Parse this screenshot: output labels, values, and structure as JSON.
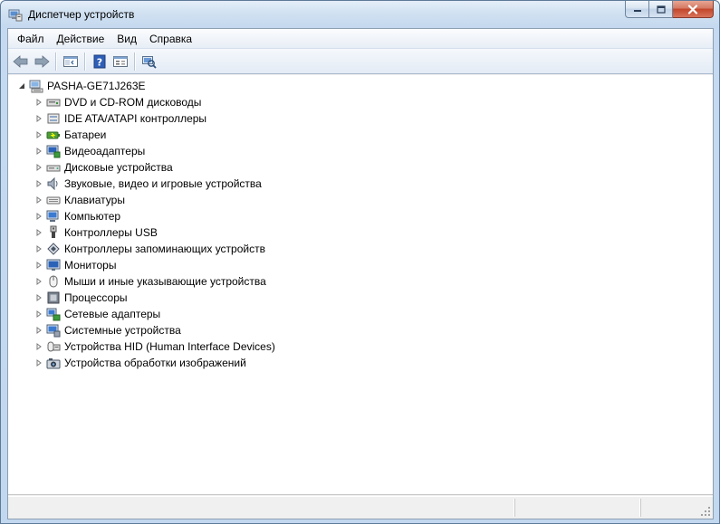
{
  "window": {
    "title": "Диспетчер устройств"
  },
  "menu": [
    "Файл",
    "Действие",
    "Вид",
    "Справка"
  ],
  "toolbar": {
    "buttons": [
      "back-icon",
      "forward-icon",
      "show-hide-tree-icon",
      "help-icon",
      "properties-icon",
      "scan-hardware-icon"
    ]
  },
  "tree": {
    "root": "PASHA-GE71J263E",
    "items": [
      {
        "label": "DVD и CD-ROM дисководы",
        "icon": "dvd-drive-icon"
      },
      {
        "label": "IDE ATA/ATAPI контроллеры",
        "icon": "ide-controller-icon"
      },
      {
        "label": "Батареи",
        "icon": "battery-icon"
      },
      {
        "label": "Видеоадаптеры",
        "icon": "display-adapter-icon"
      },
      {
        "label": "Дисковые устройства",
        "icon": "disk-drive-icon"
      },
      {
        "label": "Звуковые, видео и игровые устройства",
        "icon": "sound-icon"
      },
      {
        "label": "Клавиатуры",
        "icon": "keyboard-icon"
      },
      {
        "label": "Компьютер",
        "icon": "computer-icon"
      },
      {
        "label": "Контроллеры USB",
        "icon": "usb-icon"
      },
      {
        "label": "Контроллеры запоминающих устройств",
        "icon": "storage-controller-icon"
      },
      {
        "label": "Мониторы",
        "icon": "monitor-icon"
      },
      {
        "label": "Мыши и иные указывающие устройства",
        "icon": "mouse-icon"
      },
      {
        "label": "Процессоры",
        "icon": "processor-icon"
      },
      {
        "label": "Сетевые адаптеры",
        "icon": "network-adapter-icon"
      },
      {
        "label": "Системные устройства",
        "icon": "system-devices-icon"
      },
      {
        "label": "Устройства HID (Human Interface Devices)",
        "icon": "hid-icon"
      },
      {
        "label": "Устройства обработки изображений",
        "icon": "imaging-device-icon"
      }
    ]
  }
}
